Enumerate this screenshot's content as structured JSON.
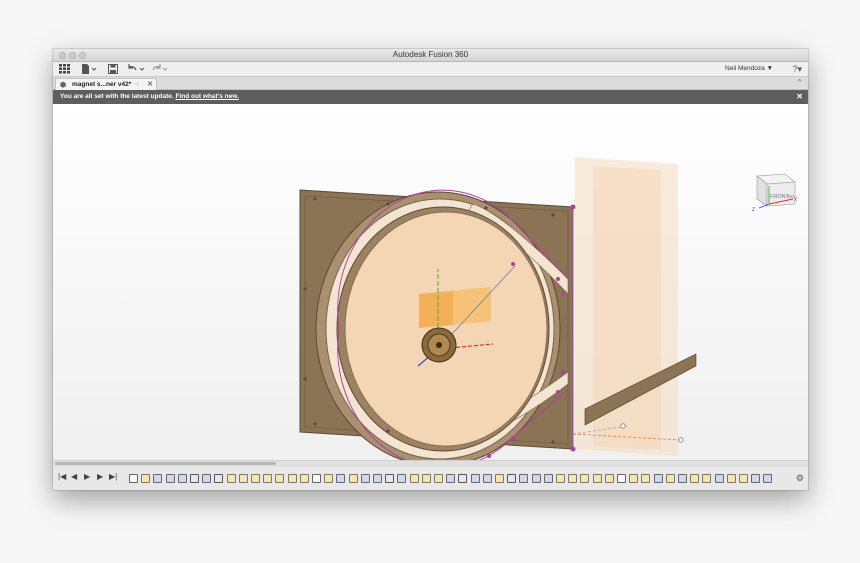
{
  "window": {
    "title": "Autodesk Fusion 360"
  },
  "toolbar": {
    "grid_icon": "grid-icon",
    "file_icon": "file-icon",
    "save_icon": "save-icon",
    "undo_icon": "undo-icon",
    "redo_icon": "redo-icon",
    "user_name": "Neil Mendoza ▼",
    "help_label": "?▾"
  },
  "tab": {
    "label": "magnet s...ner v42*",
    "close_label": "✕",
    "icon": "part-cube-icon"
  },
  "banner": {
    "message": "You are all set with the latest update.",
    "link": "Find out what's new.",
    "close_label": "✕"
  },
  "viewcube": {
    "front_label": "FRONT",
    "side_label": "SID",
    "axis_x": "X",
    "axis_z": "Z",
    "axis_y": "Y"
  },
  "timeline": {
    "controls": [
      "|◀",
      "◀",
      "▶",
      "▶",
      "▶|"
    ],
    "features": [
      "box",
      "sketch",
      "body",
      "body",
      "body",
      "move",
      "body",
      "move",
      "sketch",
      "sketch",
      "sketch",
      "sketch",
      "sketch",
      "sketch",
      "sketch",
      "box",
      "sketch",
      "body",
      "sketch",
      "body",
      "body",
      "move",
      "body",
      "sketch",
      "sketch",
      "sketch",
      "body",
      "move",
      "body",
      "body",
      "sketch",
      "move",
      "body",
      "body",
      "body",
      "sketch",
      "sketch",
      "sketch",
      "sketch",
      "sketch",
      "box",
      "sketch",
      "sketch",
      "body",
      "sketch",
      "body",
      "sketch",
      "sketch",
      "body",
      "sketch",
      "sketch",
      "body",
      "body"
    ],
    "settings_icon": "gear-icon"
  },
  "colors": {
    "banner_bg": "#5e5e5e",
    "model_frame": "#8b7355",
    "model_face": "#f5d6b4",
    "sketch_line": "#b040a0",
    "axis_orange": "#e08030",
    "axis_green": "#40b040",
    "axis_red": "#e03030",
    "axis_blue": "#3050d0"
  }
}
